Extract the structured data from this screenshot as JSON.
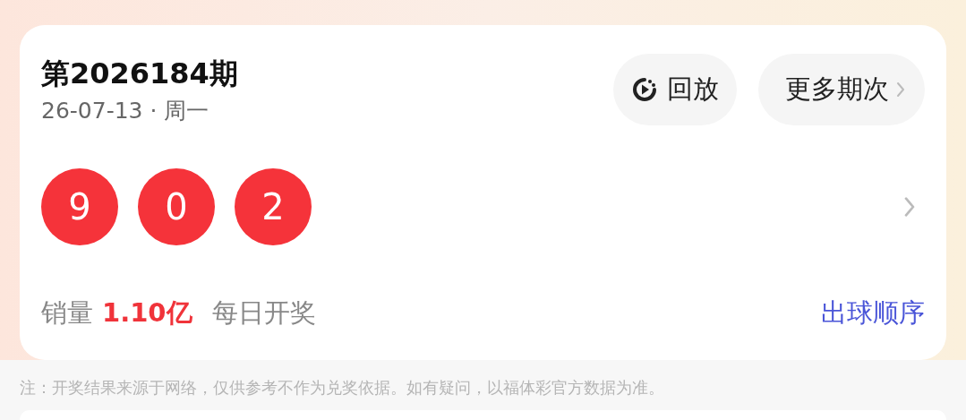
{
  "draw": {
    "title": "第2026184期",
    "date": "26-07-13 · 周一",
    "buttons": [
      {
        "kind": "replay",
        "label": "回放"
      },
      {
        "kind": "more",
        "label": "更多期次"
      }
    ],
    "balls": [
      "9",
      "0",
      "2"
    ],
    "sales_label": "销量",
    "sales_value": "1.10亿",
    "schedule": "每日开奖",
    "order_link": "出球顺序"
  },
  "note": "注：开奖结果来源于网络，仅供参考不作为兑奖依据。如有疑问，以福体彩官方数据为准。"
}
